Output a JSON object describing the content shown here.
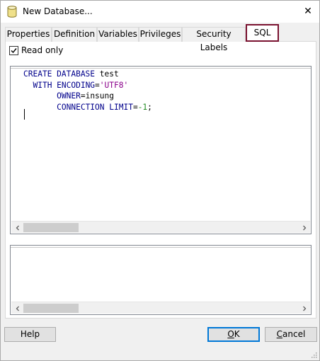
{
  "window": {
    "title": "New Database...",
    "close_glyph": "✕"
  },
  "tabs": [
    {
      "label": "Properties"
    },
    {
      "label": "Definition"
    },
    {
      "label": "Variables"
    },
    {
      "label": "Privileges"
    },
    {
      "label": "Security Labels"
    },
    {
      "label": "SQL",
      "active": true
    }
  ],
  "readonly": {
    "label": "Read only",
    "checked": true
  },
  "sql": {
    "line1_kw": "CREATE DATABASE",
    "line1_name": " test",
    "line2_kw": "WITH ENCODING",
    "line2_eq": "=",
    "line2_str": "'UTF8'",
    "line3_kw": "OWNER",
    "line3_rest": "=insung",
    "line4_kw": "CONNECTION LIMIT",
    "line4_eq": "=",
    "line4_num": "-1",
    "line4_end": ";"
  },
  "buttons": {
    "help": "Help",
    "ok_mnemonic": "O",
    "ok_rest": "K",
    "cancel_mnemonic": "C",
    "cancel_rest": "ancel"
  },
  "icons": {
    "title": "database-icon",
    "close": "close-icon",
    "scroll_left": "chevron-left-icon",
    "scroll_right": "chevron-right-icon",
    "grip": "resize-grip-icon"
  },
  "colors": {
    "keyword": "#00008b",
    "string": "#8b008b",
    "number": "#228b22",
    "active_tab_border": "#7a1230",
    "primary_button_border": "#0078d7"
  }
}
